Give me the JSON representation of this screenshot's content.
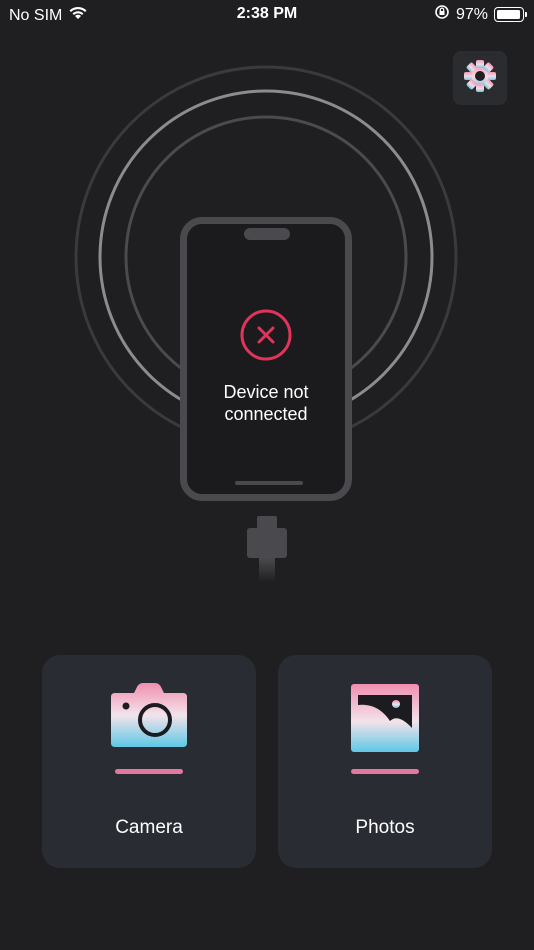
{
  "status_bar": {
    "carrier": "No SIM",
    "time": "2:38 PM",
    "battery_percent": "97%",
    "battery_level": 0.97,
    "icons": [
      "wifi-icon",
      "orientation-lock-icon",
      "battery-icon"
    ]
  },
  "settings": {
    "icon": "gear-icon"
  },
  "device": {
    "status_line1": "Device not",
    "status_line2": "connected",
    "status_icon": "error-x-icon"
  },
  "tiles": [
    {
      "label": "Camera",
      "icon": "camera-icon"
    },
    {
      "label": "Photos",
      "icon": "photo-gallery-icon"
    }
  ],
  "colors": {
    "background": "#1f1f21",
    "tile_bg": "#2a2c33",
    "accent_pink": "#e2789b",
    "error_red": "#e0345c"
  }
}
